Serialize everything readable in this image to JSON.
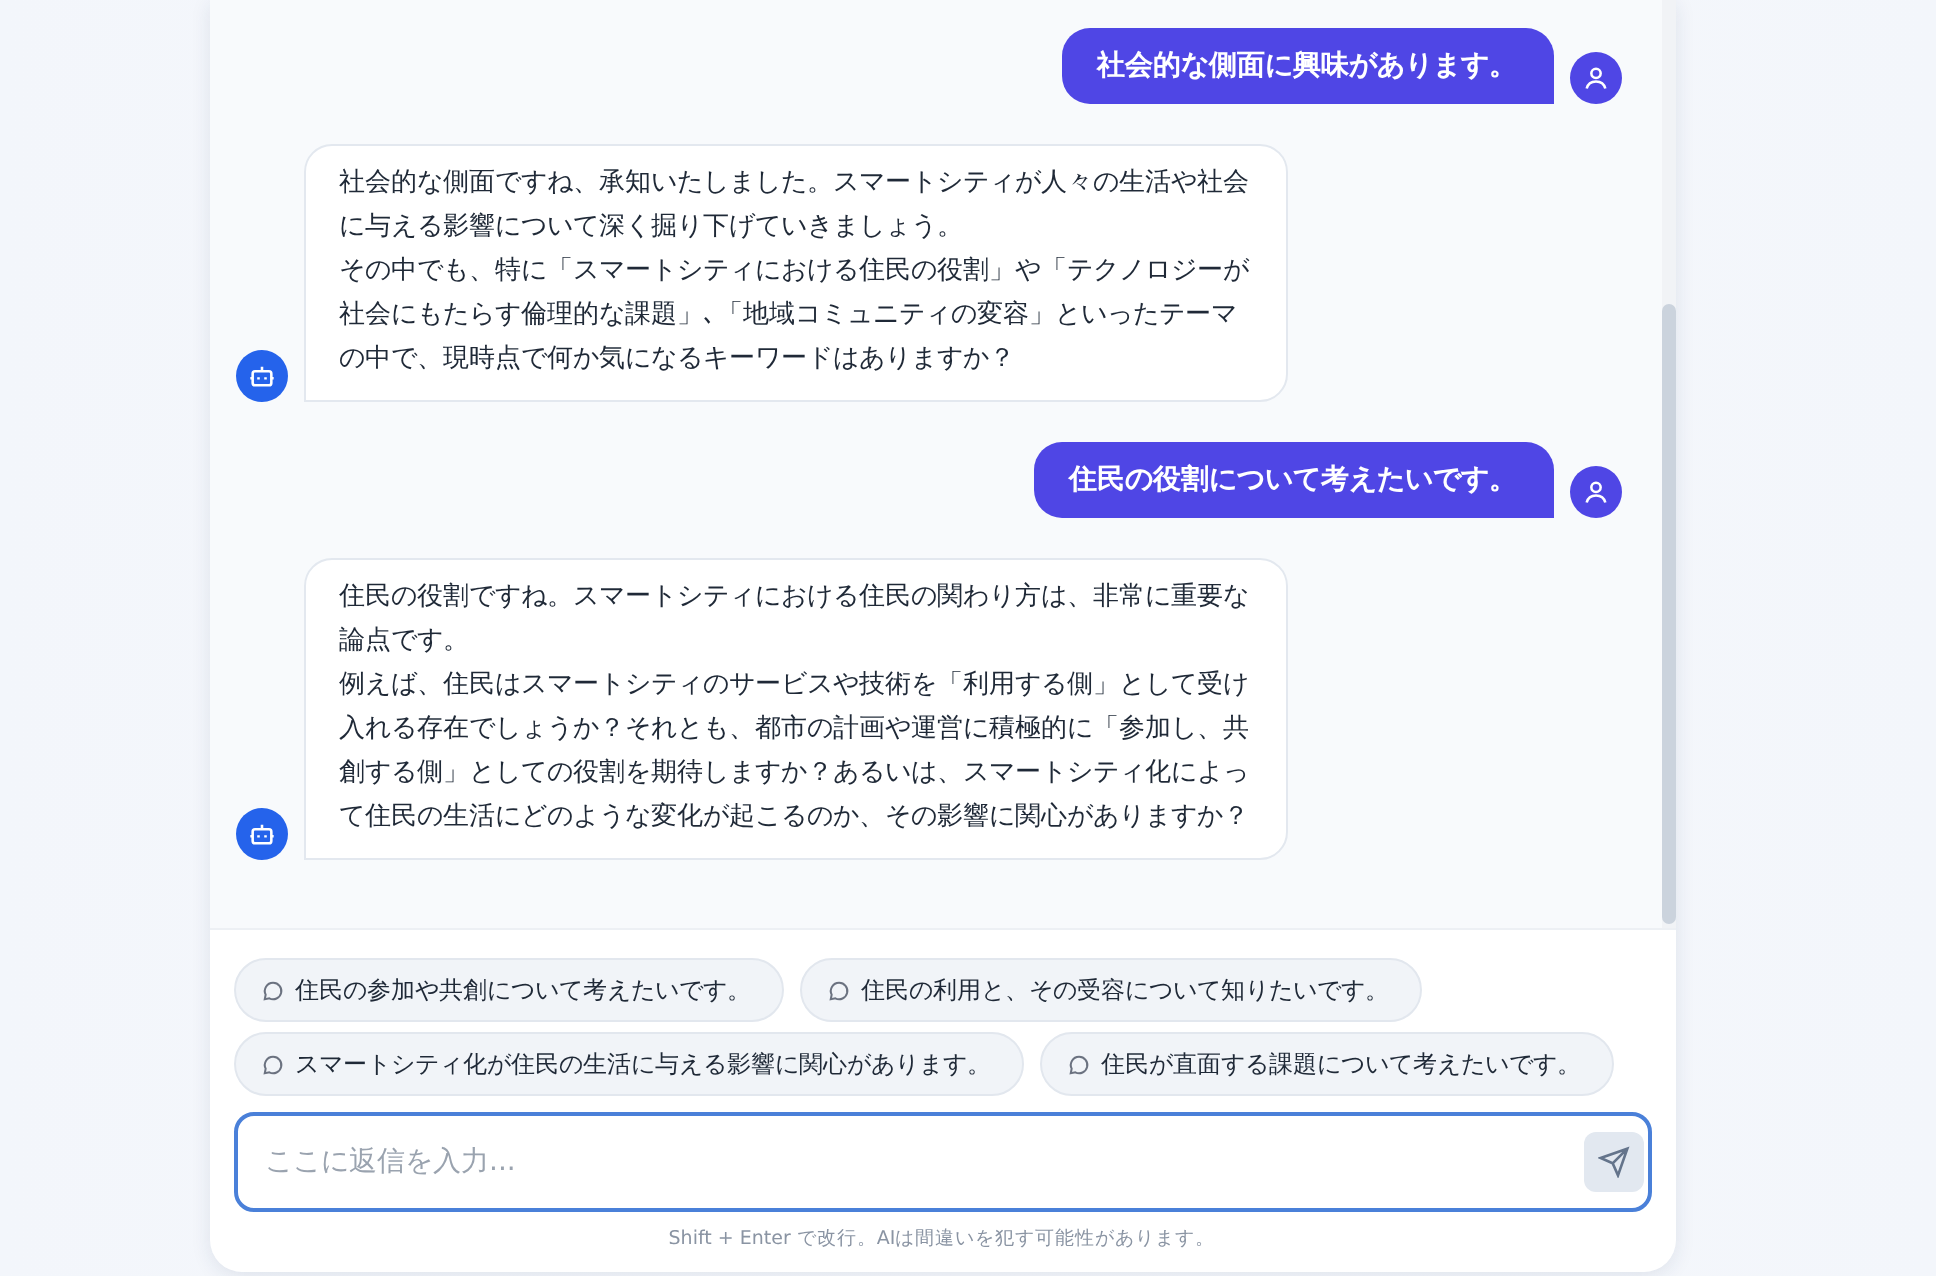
{
  "messages": [
    {
      "kind": "user",
      "paragraphs": [
        "社会的な側面に興味があります。"
      ]
    },
    {
      "kind": "bot",
      "paragraphs": [
        "社会的な側面ですね、承知いたしました。スマートシティが人々の生活や社会に与える影響について深く掘り下げていきましょう。",
        "その中でも、特に「スマートシティにおける住民の役割」や「テクノロジーが社会にもたらす倫理的な課題」､「地域コミュニティの変容」といったテーマの中で、現時点で何か気になるキーワードはありますか？"
      ]
    },
    {
      "kind": "user",
      "paragraphs": [
        "住民の役割について考えたいです。"
      ]
    },
    {
      "kind": "bot",
      "paragraphs": [
        "住民の役割ですね。スマートシティにおける住民の関わり方は、非常に重要な論点です。",
        "例えば、住民はスマートシティのサービスや技術を「利用する側」として受け入れる存在でしょうか？それとも、都市の計画や運営に積極的に「参加し、共創する側」としての役割を期待しますか？あるいは、スマートシティ化によって住民の生活にどのような変化が起こるのか、その影響に関心がありますか？"
      ]
    }
  ],
  "suggestions": [
    [
      "住民の参加や共創について考えたいです。",
      "住民の利用と、その受容について知りたいです。"
    ],
    [
      "スマートシティ化が住民の生活に与える影響に関心があります。",
      "住民が直面する課題について考えたいです。"
    ]
  ],
  "input": {
    "placeholder": "ここに返信を入力..."
  },
  "footer": "Shift + Enter で改行。AIは間違いを犯す可能性があります。"
}
